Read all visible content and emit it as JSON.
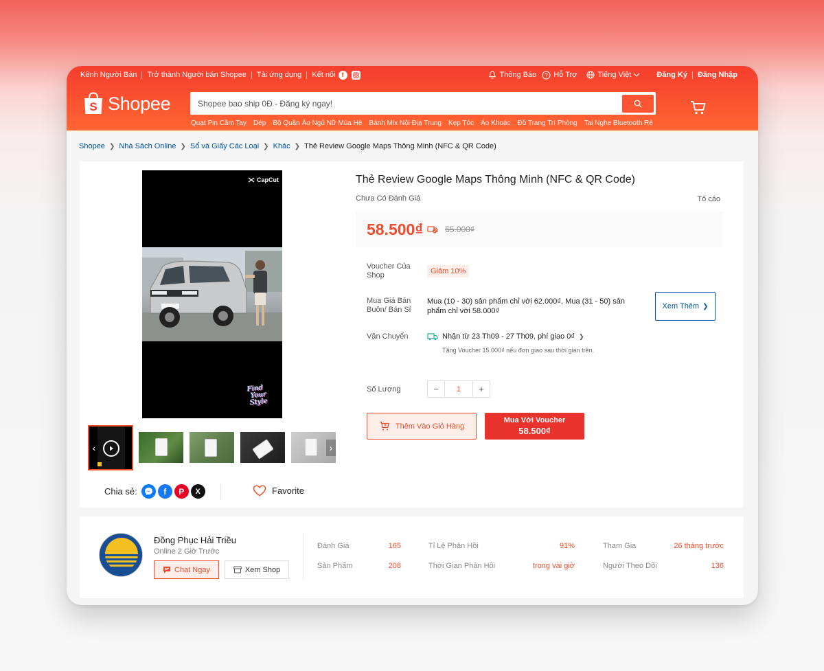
{
  "topbar": {
    "left_items": [
      "Kênh Người Bán",
      "Trở thành Người bán Shopee",
      "Tải ứng dụng"
    ],
    "connect": "Kết nối",
    "social_icons": [
      "facebook-icon",
      "instagram-icon"
    ],
    "notifications": "Thông Báo",
    "support": "Hỗ Trợ",
    "language": "Tiếng Việt",
    "register": "Đăng Ký",
    "login": "Đăng Nhập"
  },
  "header": {
    "logo_text": "Shopee",
    "search_placeholder": "Shopee bao ship 0Đ - Đăng ký ngay!",
    "suggestions": [
      "Quạt Pin Cầm Tay",
      "Dép",
      "Bộ Quần Áo Ngủ Nữ Mùa Hè",
      "Bánh Mix Nội Địa Trung",
      "Kẹp Tóc",
      "Áo Khoác",
      "Đồ Trang Trí Phòng",
      "Tai Nghe Bluetooth Rẻ"
    ]
  },
  "breadcrumb": {
    "items": [
      "Shopee",
      "Nhà Sách Online",
      "Sổ và Giấy Các Loại",
      "Khác"
    ],
    "current": "Thẻ Review Google Maps Thông Minh (NFC & QR Code)"
  },
  "gallery": {
    "watermark": "CapCut",
    "sticker_lines": [
      "Find",
      "Your",
      "Style"
    ]
  },
  "share": {
    "label": "Chia sẻ:",
    "icons": [
      "messenger-icon",
      "facebook-icon",
      "pinterest-icon",
      "x-icon"
    ]
  },
  "favorite": {
    "label": "Favorite"
  },
  "product": {
    "title": "Thẻ Review Google Maps Thông Minh (NFC & QR Code)",
    "rating_text": "Chưa Có Đánh Giá",
    "report": "Tố cáo",
    "price": "58.500₫",
    "original_price": "65.000₫",
    "voucher_label": "Voucher Của Shop",
    "voucher_badge": "Giảm 10%",
    "wholesale_label": "Mua Giá Bán Buôn/ Bán Sỉ",
    "wholesale_text": "Mua (10 - 30) sản phẩm chỉ với 62.000₫, Mua (31 - 50) sản phẩm chỉ với 58.000₫",
    "see_more": "Xem Thêm",
    "shipping_label": "Vận Chuyển",
    "shipping_text": "Nhận từ 23 Th09 - 27 Th09, phí giao 0₫",
    "shipping_sub": "Tặng Voucher 15.000₫ nếu đơn giao sau thời gian trên.",
    "quantity_label": "Số Lượng",
    "quantity": "1",
    "add_to_cart": "Thêm Vào Giỏ Hàng",
    "buy_line1": "Mua Với Voucher",
    "buy_line2": "58.500₫"
  },
  "shop": {
    "name": "Đồng Phục Hải Triều",
    "online": "Online 2 Giờ Trước",
    "chat": "Chat Ngay",
    "view_shop": "Xem Shop",
    "stats": [
      {
        "label": "Đánh Giá",
        "value": "165"
      },
      {
        "label": "Sản Phẩm",
        "value": "208"
      },
      {
        "label": "Tỉ Lệ Phản Hồi",
        "value": "91%"
      },
      {
        "label": "Thời Gian Phản Hồi",
        "value": "trong vài giờ"
      },
      {
        "label": "Tham Gia",
        "value": "26 tháng trước"
      },
      {
        "label": "Người Theo Dõi",
        "value": "136"
      }
    ]
  },
  "colors": {
    "brand": "#ee4d2d",
    "header_gradient_start": "#f53d2d",
    "header_gradient_end": "#ff6633",
    "link": "#0055aa"
  }
}
